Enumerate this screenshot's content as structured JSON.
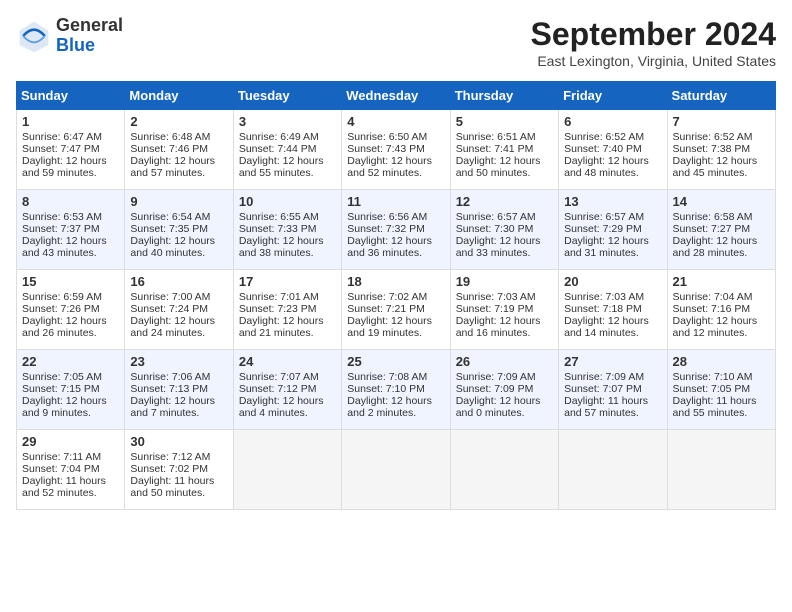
{
  "header": {
    "logo_line1": "General",
    "logo_line2": "Blue",
    "title": "September 2024",
    "location": "East Lexington, Virginia, United States"
  },
  "days_of_week": [
    "Sunday",
    "Monday",
    "Tuesday",
    "Wednesday",
    "Thursday",
    "Friday",
    "Saturday"
  ],
  "weeks": [
    [
      {
        "day": 1,
        "lines": [
          "Sunrise: 6:47 AM",
          "Sunset: 7:47 PM",
          "Daylight: 12 hours",
          "and 59 minutes."
        ]
      },
      {
        "day": 2,
        "lines": [
          "Sunrise: 6:48 AM",
          "Sunset: 7:46 PM",
          "Daylight: 12 hours",
          "and 57 minutes."
        ]
      },
      {
        "day": 3,
        "lines": [
          "Sunrise: 6:49 AM",
          "Sunset: 7:44 PM",
          "Daylight: 12 hours",
          "and 55 minutes."
        ]
      },
      {
        "day": 4,
        "lines": [
          "Sunrise: 6:50 AM",
          "Sunset: 7:43 PM",
          "Daylight: 12 hours",
          "and 52 minutes."
        ]
      },
      {
        "day": 5,
        "lines": [
          "Sunrise: 6:51 AM",
          "Sunset: 7:41 PM",
          "Daylight: 12 hours",
          "and 50 minutes."
        ]
      },
      {
        "day": 6,
        "lines": [
          "Sunrise: 6:52 AM",
          "Sunset: 7:40 PM",
          "Daylight: 12 hours",
          "and 48 minutes."
        ]
      },
      {
        "day": 7,
        "lines": [
          "Sunrise: 6:52 AM",
          "Sunset: 7:38 PM",
          "Daylight: 12 hours",
          "and 45 minutes."
        ]
      }
    ],
    [
      {
        "day": 8,
        "lines": [
          "Sunrise: 6:53 AM",
          "Sunset: 7:37 PM",
          "Daylight: 12 hours",
          "and 43 minutes."
        ]
      },
      {
        "day": 9,
        "lines": [
          "Sunrise: 6:54 AM",
          "Sunset: 7:35 PM",
          "Daylight: 12 hours",
          "and 40 minutes."
        ]
      },
      {
        "day": 10,
        "lines": [
          "Sunrise: 6:55 AM",
          "Sunset: 7:33 PM",
          "Daylight: 12 hours",
          "and 38 minutes."
        ]
      },
      {
        "day": 11,
        "lines": [
          "Sunrise: 6:56 AM",
          "Sunset: 7:32 PM",
          "Daylight: 12 hours",
          "and 36 minutes."
        ]
      },
      {
        "day": 12,
        "lines": [
          "Sunrise: 6:57 AM",
          "Sunset: 7:30 PM",
          "Daylight: 12 hours",
          "and 33 minutes."
        ]
      },
      {
        "day": 13,
        "lines": [
          "Sunrise: 6:57 AM",
          "Sunset: 7:29 PM",
          "Daylight: 12 hours",
          "and 31 minutes."
        ]
      },
      {
        "day": 14,
        "lines": [
          "Sunrise: 6:58 AM",
          "Sunset: 7:27 PM",
          "Daylight: 12 hours",
          "and 28 minutes."
        ]
      }
    ],
    [
      {
        "day": 15,
        "lines": [
          "Sunrise: 6:59 AM",
          "Sunset: 7:26 PM",
          "Daylight: 12 hours",
          "and 26 minutes."
        ]
      },
      {
        "day": 16,
        "lines": [
          "Sunrise: 7:00 AM",
          "Sunset: 7:24 PM",
          "Daylight: 12 hours",
          "and 24 minutes."
        ]
      },
      {
        "day": 17,
        "lines": [
          "Sunrise: 7:01 AM",
          "Sunset: 7:23 PM",
          "Daylight: 12 hours",
          "and 21 minutes."
        ]
      },
      {
        "day": 18,
        "lines": [
          "Sunrise: 7:02 AM",
          "Sunset: 7:21 PM",
          "Daylight: 12 hours",
          "and 19 minutes."
        ]
      },
      {
        "day": 19,
        "lines": [
          "Sunrise: 7:03 AM",
          "Sunset: 7:19 PM",
          "Daylight: 12 hours",
          "and 16 minutes."
        ]
      },
      {
        "day": 20,
        "lines": [
          "Sunrise: 7:03 AM",
          "Sunset: 7:18 PM",
          "Daylight: 12 hours",
          "and 14 minutes."
        ]
      },
      {
        "day": 21,
        "lines": [
          "Sunrise: 7:04 AM",
          "Sunset: 7:16 PM",
          "Daylight: 12 hours",
          "and 12 minutes."
        ]
      }
    ],
    [
      {
        "day": 22,
        "lines": [
          "Sunrise: 7:05 AM",
          "Sunset: 7:15 PM",
          "Daylight: 12 hours",
          "and 9 minutes."
        ]
      },
      {
        "day": 23,
        "lines": [
          "Sunrise: 7:06 AM",
          "Sunset: 7:13 PM",
          "Daylight: 12 hours",
          "and 7 minutes."
        ]
      },
      {
        "day": 24,
        "lines": [
          "Sunrise: 7:07 AM",
          "Sunset: 7:12 PM",
          "Daylight: 12 hours",
          "and 4 minutes."
        ]
      },
      {
        "day": 25,
        "lines": [
          "Sunrise: 7:08 AM",
          "Sunset: 7:10 PM",
          "Daylight: 12 hours",
          "and 2 minutes."
        ]
      },
      {
        "day": 26,
        "lines": [
          "Sunrise: 7:09 AM",
          "Sunset: 7:09 PM",
          "Daylight: 12 hours",
          "and 0 minutes."
        ]
      },
      {
        "day": 27,
        "lines": [
          "Sunrise: 7:09 AM",
          "Sunset: 7:07 PM",
          "Daylight: 11 hours",
          "and 57 minutes."
        ]
      },
      {
        "day": 28,
        "lines": [
          "Sunrise: 7:10 AM",
          "Sunset: 7:05 PM",
          "Daylight: 11 hours",
          "and 55 minutes."
        ]
      }
    ],
    [
      {
        "day": 29,
        "lines": [
          "Sunrise: 7:11 AM",
          "Sunset: 7:04 PM",
          "Daylight: 11 hours",
          "and 52 minutes."
        ]
      },
      {
        "day": 30,
        "lines": [
          "Sunrise: 7:12 AM",
          "Sunset: 7:02 PM",
          "Daylight: 11 hours",
          "and 50 minutes."
        ]
      },
      null,
      null,
      null,
      null,
      null
    ]
  ]
}
